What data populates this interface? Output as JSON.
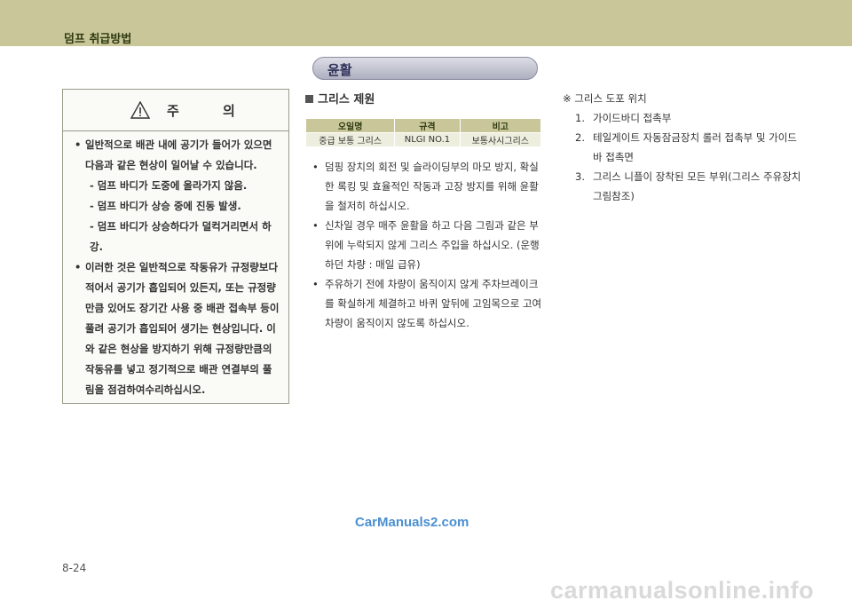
{
  "header": {
    "title": "덤프 취급방법"
  },
  "section": {
    "title": "윤활"
  },
  "caution": {
    "title": "주 의",
    "items": [
      {
        "text": "일반적으로 배관 내에 공기가 들어가 있으면 다음과 같은 현상이 일어날 수 있습니다.",
        "subs": [
          "- 덤프 바디가 도중에 올라가지 않음.",
          "- 덤프 바디가 상승 중에 진동 발생.",
          "- 덤프 바디가 상승하다가 덜컥거리면서 하강."
        ]
      },
      {
        "text": "이러한 것은 일반적으로 작동유가 규정량보다 적어서 공기가 흡입되어 있든지, 또는 규정량만큼 있어도 장기간 사용 중 배관 접속부 등이 풀려 공기가 흡입되어 생기는 현상입니다. 이와 같은 현상을 방지하기 위해 규정량만큼의 작동유를 넣고 정기적으로 배관 연결부의 풀림을 점검하여수리하십시오.",
        "subs": []
      }
    ]
  },
  "grease": {
    "title": "그리스 제원",
    "table": {
      "headers": [
        "오일명",
        "규격",
        "비고"
      ],
      "rows": [
        [
          "중급 보통 그리스",
          "NLGI NO.1",
          "보통사시그리스"
        ]
      ]
    },
    "items": [
      "덤핑 장치의 회전 및 슬라이딩부의 마모 방지, 확실한 록킹 및 효율적인 작동과 고장 방지를 위해 윤활을 철저히 하십시오.",
      "신차일 경우 매주 윤활을 하고 다음 그림과 같은 부위에 누락되지 않게 그리스 주입을 하십시오. (운행하던 차량 : 매일 급유)",
      "주유하기 전에 차량이 움직이지 않게 주차브레이크를 확실하게 체결하고 바퀴 앞뒤에 고임목으로 고여 차량이 움직이지 않도록 하십시오."
    ]
  },
  "grease_points": {
    "note": "※ 그리스 도포 위치",
    "items": [
      {
        "num": "1.",
        "text": "가이드바디 접촉부"
      },
      {
        "num": "2.",
        "text": "테일게이트 자동잠금장치 롤러 접촉부 및 가이드바 접촉면"
      },
      {
        "num": "3.",
        "text": "그리스 니플이 장착된 모든 부위(그리스 주유장치 그림참조)"
      }
    ]
  },
  "page_number": "8-24",
  "watermark": "CarManuals2.com",
  "footer_url": "carmanualsonline.info",
  "colors": {
    "header_band": "#c9c79a",
    "table_header": "#c9c79a",
    "table_row": "#eeeedf",
    "watermark": "#4a8fd0"
  }
}
